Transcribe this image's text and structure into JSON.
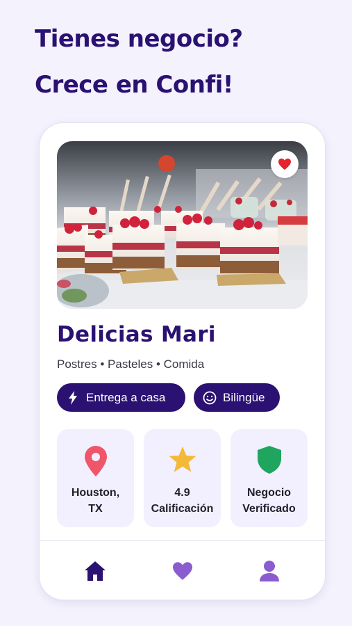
{
  "headline": {
    "line1": "Tienes negocio?",
    "line2": "Crece en Confi!"
  },
  "card": {
    "business_name": "Delicias Mari",
    "categories": "Postres • Pasteles • Comida",
    "favorite_icon": "heart-icon",
    "tags": [
      {
        "label": "Entrega a casa",
        "icon": "lightning-icon"
      },
      {
        "label": "Bilingüe",
        "icon": "smile-icon"
      }
    ],
    "stats": [
      {
        "line1": "Houston,",
        "line2": "TX",
        "icon": "location-pin-icon",
        "color": "#f0566a"
      },
      {
        "line1": "4.9",
        "line2": "Calificación",
        "icon": "star-icon",
        "color": "#f5b93a"
      },
      {
        "line1": "Negocio",
        "line2": "Verificado",
        "icon": "shield-icon",
        "color": "#1fa55e"
      }
    ]
  },
  "bottom_nav": {
    "items": [
      {
        "name": "home",
        "icon": "home-icon",
        "color": "#2a1172"
      },
      {
        "name": "favorites",
        "icon": "heart-icon",
        "color": "#8a5cd0"
      },
      {
        "name": "profile",
        "icon": "user-icon",
        "color": "#8a5cd0"
      }
    ]
  },
  "colors": {
    "brand_dark": "#2a1172",
    "background": "#f3f2fd",
    "tile_bg": "#f2f0fe",
    "favorite_red": "#e5232e"
  }
}
